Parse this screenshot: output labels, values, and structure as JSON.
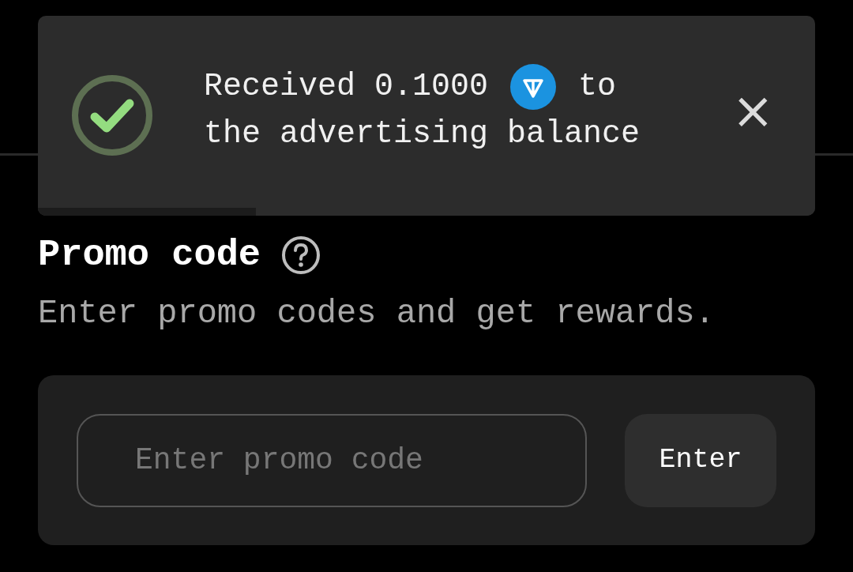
{
  "toast": {
    "message_before": "Received 0.1000",
    "message_after": "to",
    "message_line2": "the advertising balance",
    "close": "×",
    "progress": {
      "level": 0.28
    }
  },
  "promo": {
    "title": "Promo code",
    "subtitle": "Enter promo codes and get rewards.",
    "input": {
      "placeholder": "Enter promo code"
    },
    "button": "Enter"
  }
}
